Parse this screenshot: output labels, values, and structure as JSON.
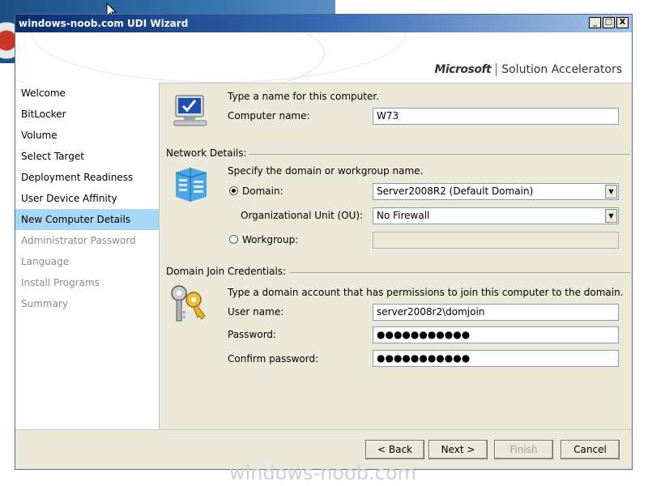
{
  "window": {
    "title": "windows-noob.com UDI Wizard",
    "min": "_",
    "max": "□",
    "close": "X"
  },
  "brand": {
    "company": "Microsoft",
    "product": "Solution Accelerators"
  },
  "sidebar": {
    "items": [
      {
        "label": "Welcome",
        "state": "normal"
      },
      {
        "label": "BitLocker",
        "state": "normal"
      },
      {
        "label": "Volume",
        "state": "normal"
      },
      {
        "label": "Select Target",
        "state": "normal"
      },
      {
        "label": "Deployment Readiness",
        "state": "normal"
      },
      {
        "label": "User Device Affinity",
        "state": "normal"
      },
      {
        "label": "New Computer Details",
        "state": "active"
      },
      {
        "label": "Administrator Password",
        "state": "disabled"
      },
      {
        "label": "Language",
        "state": "disabled"
      },
      {
        "label": "Install Programs",
        "state": "disabled"
      },
      {
        "label": "Summary",
        "state": "disabled"
      }
    ]
  },
  "computer": {
    "prompt": "Type a name for this computer.",
    "name_label": "Computer name:",
    "name_value": "W73"
  },
  "network": {
    "heading": "Network Details:",
    "prompt": "Specify the domain or workgroup name.",
    "domain_label": "Domain:",
    "domain_value": "Server2008R2 (Default Domain)",
    "ou_label": "Organizational Unit (OU):",
    "ou_value": "No Firewall",
    "workgroup_label": "Workgroup:",
    "workgroup_value": ""
  },
  "credentials": {
    "heading": "Domain Join Credentials:",
    "prompt": "Type a domain account that has permissions to join this computer to the domain.",
    "user_label": "User name:",
    "user_value": "server2008r2\\domjoin",
    "password_label": "Password:",
    "password_value": "●●●●●●●●●●●",
    "confirm_label": "Confirm password:",
    "confirm_value": "●●●●●●●●●●●"
  },
  "buttons": {
    "back": "< Back",
    "next": "Next >",
    "finish": "Finish",
    "cancel": "Cancel"
  },
  "watermark": "windows-noob.com",
  "colors": {
    "active_nav": "#a7d8f7",
    "title_bar": "#0a2d6e",
    "window_bg": "#ece9d8"
  }
}
